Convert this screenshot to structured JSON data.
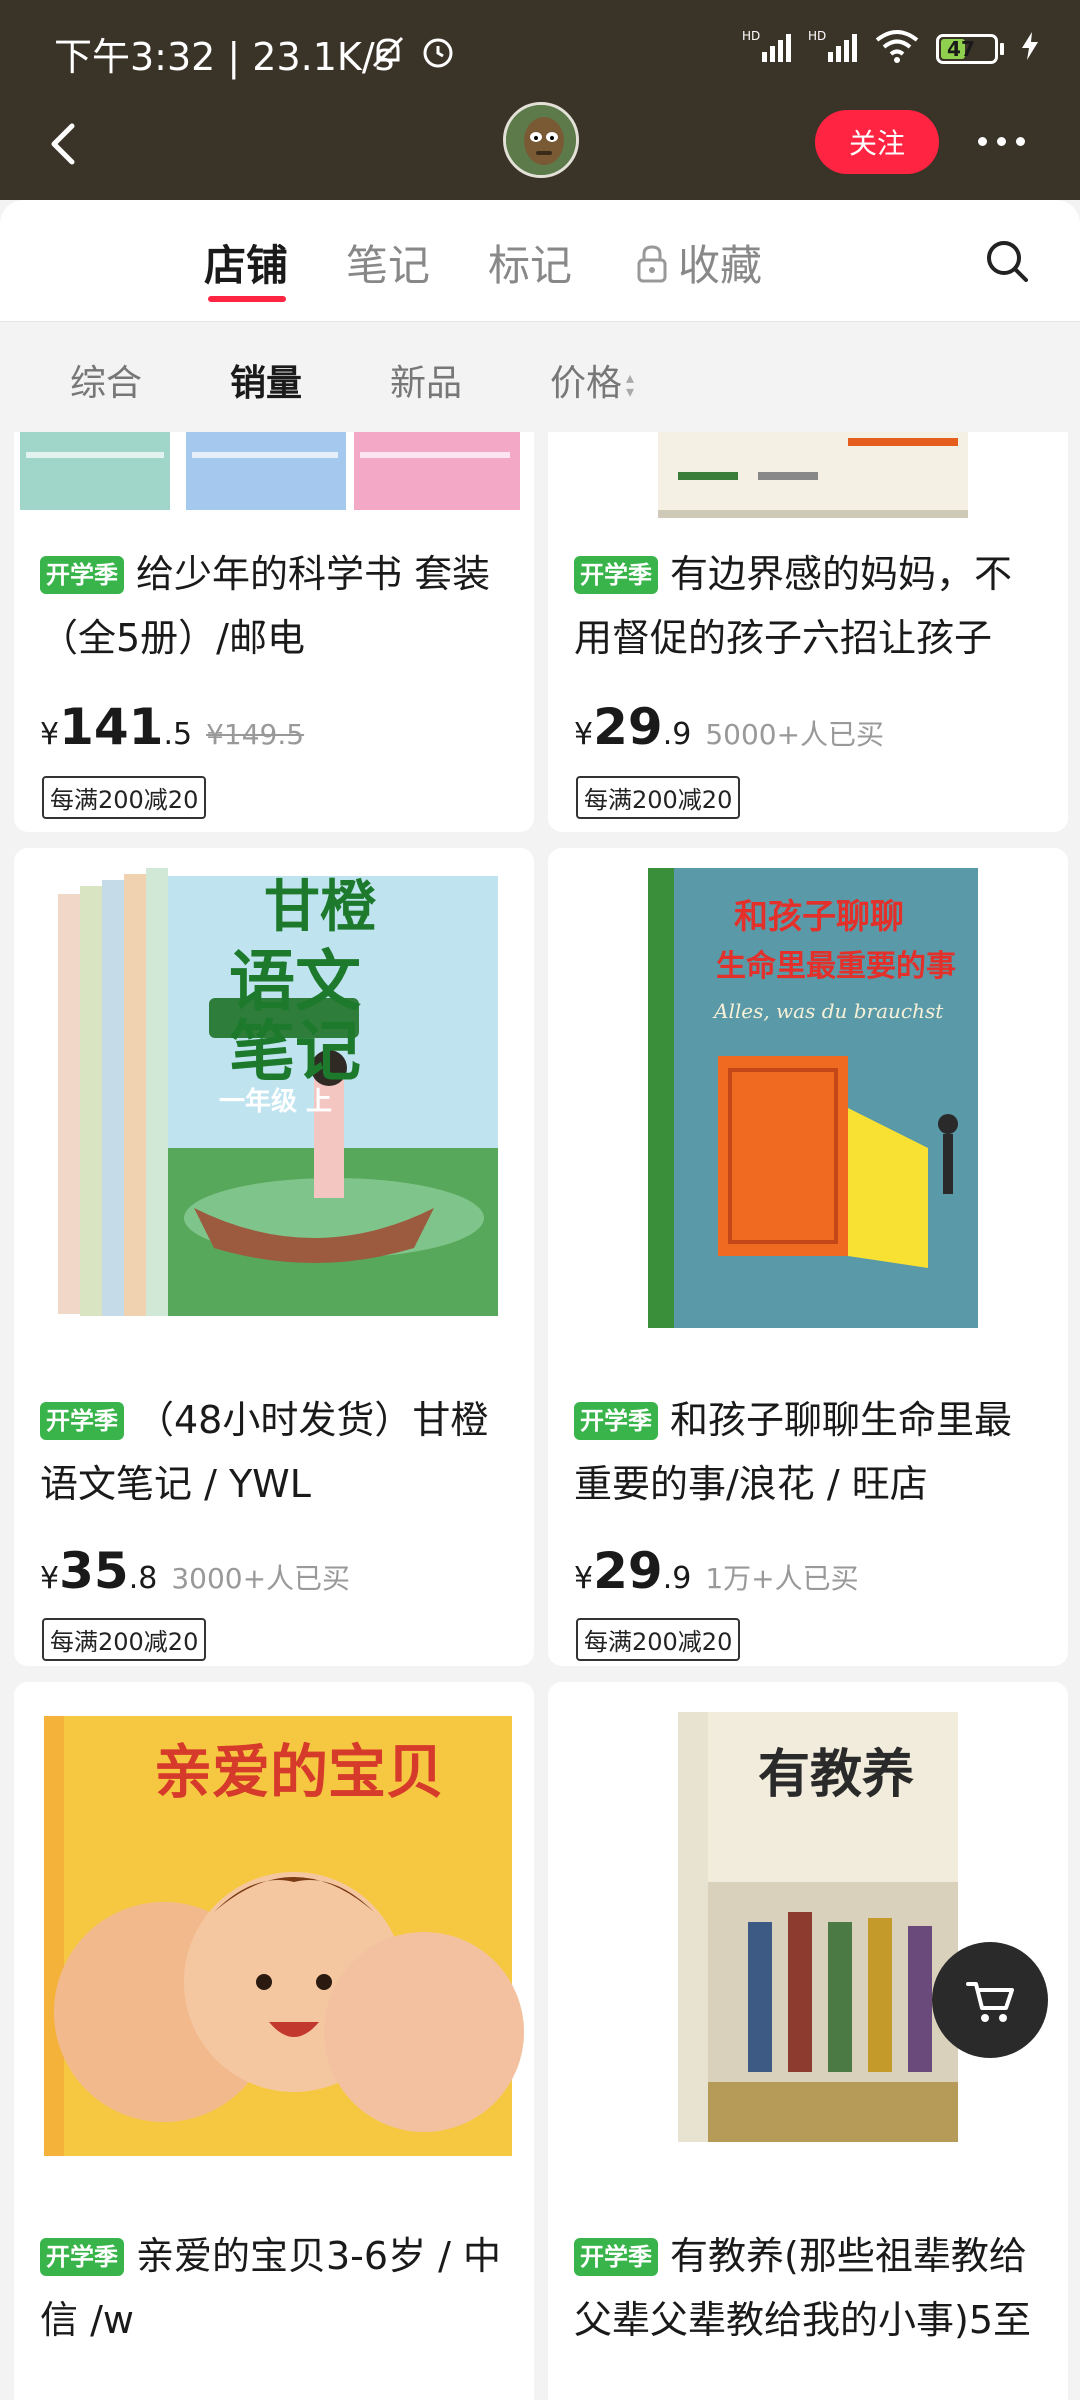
{
  "status_bar": {
    "time_speed": "下午3:32 | 23.1K/s",
    "battery": "47",
    "network_1": "HD",
    "network_2": "HD"
  },
  "header": {
    "follow_label": "关注"
  },
  "tabs": [
    {
      "label": "店铺",
      "active": true
    },
    {
      "label": "笔记",
      "active": false
    },
    {
      "label": "标记",
      "active": false
    },
    {
      "label": "收藏",
      "active": false
    }
  ],
  "filters": [
    {
      "label": "综合"
    },
    {
      "label": "销量"
    },
    {
      "label": "新品"
    },
    {
      "label": "价格"
    }
  ],
  "products": [
    {
      "tag": "开学季",
      "title": "给少年的科学书  套装（全5册）/邮电",
      "price_int": "141",
      "price_dec": ".5",
      "original_price": "¥149.5",
      "promo": "每满200减20"
    },
    {
      "tag": "开学季",
      "title": "有边界感的妈妈，不用督促的孩子六招让孩子",
      "price_int": "29",
      "price_dec": ".9",
      "sales": "5000+人已买",
      "promo": "每满200减20"
    },
    {
      "tag": "开学季",
      "title": "（48小时发货）甘橙语文笔记 / YWL",
      "price_int": "35",
      "price_dec": ".8",
      "sales": "3000+人已买",
      "promo": "每满200减20",
      "cover_text": [
        "甘橙",
        "语文",
        "笔记",
        "一年级 上"
      ]
    },
    {
      "tag": "开学季",
      "title": "和孩子聊聊生命里最重要的事/浪花 / 旺店",
      "price_int": "29",
      "price_dec": ".9",
      "sales": "1万+人已买",
      "promo": "每满200减20",
      "cover_text": [
        "和孩子聊聊",
        "生命里最重要的事",
        "Alles, was du brauchst"
      ]
    },
    {
      "tag": "开学季",
      "title": "亲爱的宝贝3-6岁 / 中信 /w",
      "cover_text": [
        "亲爱的宝贝"
      ]
    },
    {
      "tag": "开学季",
      "title": "有教养(那些祖辈教给父辈父辈教给我的小事)5至",
      "cover_text": [
        "有教养"
      ]
    }
  ],
  "yen_symbol": "¥",
  "colors": {
    "accent": "#ff2442",
    "tag_green": "#39b44a",
    "header_bg": "#3a3328"
  }
}
